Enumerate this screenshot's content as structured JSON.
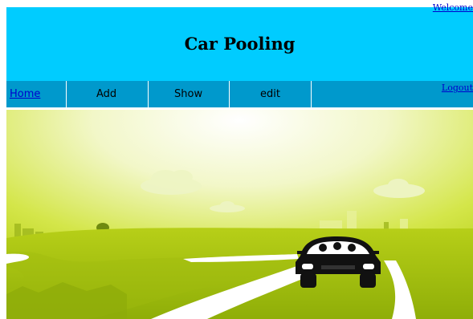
{
  "header": {
    "welcome_text": "Welcome",
    "title": "Car Pooling"
  },
  "nav": {
    "items": [
      {
        "label": "Home",
        "active": true
      },
      {
        "label": "Add"
      },
      {
        "label": "Show"
      },
      {
        "label": "edit"
      }
    ],
    "logout_label": "Logout"
  },
  "banner": {
    "image": "car-pooling-illustration"
  },
  "colors": {
    "header_bg": "#00ccff",
    "nav_bg": "#0099cc",
    "link": "#0000cc"
  }
}
